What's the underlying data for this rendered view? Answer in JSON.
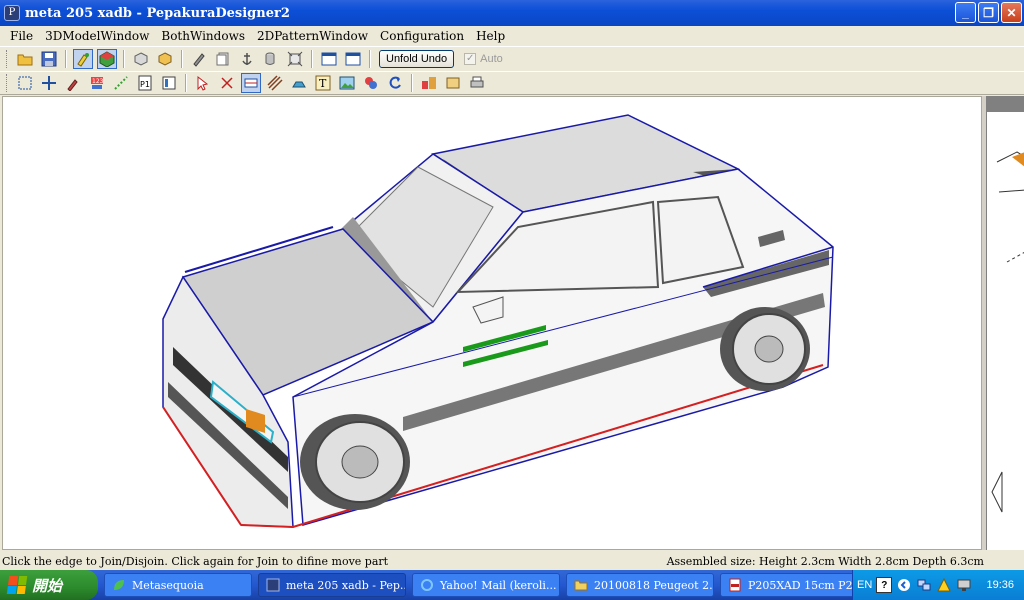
{
  "window": {
    "title": "meta 205 xadb - PepakuraDesigner2",
    "icon": "pepakura-icon",
    "controls": {
      "minimize": "_",
      "restore": "❐",
      "close": "✕"
    }
  },
  "menu": {
    "items": [
      "File",
      "3DModelWindow",
      "BothWindows",
      "2DPatternWindow",
      "Configuration",
      "Help"
    ]
  },
  "toolbar1": {
    "unfold_undo_label": "Unfold Undo",
    "auto_label": "Auto",
    "auto_checked": true,
    "auto_check_glyph": "✓"
  },
  "statusbar": {
    "hint": "Click the edge to Join/Disjoin. Click again for Join to difine move part",
    "assembled_size": "Assembled size: Height 2.3cm Width 2.8cm Depth 6.3cm"
  },
  "taskbar": {
    "start_label": "開始",
    "tasks": [
      {
        "label": "Metasequoia",
        "icon": "leaf-icon",
        "active": false
      },
      {
        "label": "meta 205 xadb - Pep...",
        "icon": "pepakura-icon",
        "active": true
      },
      {
        "label": "Yahoo! Mail (keroli...",
        "icon": "ie-icon",
        "active": false
      },
      {
        "label": "20100818 Peugeot 2...",
        "icon": "folder-icon",
        "active": false
      },
      {
        "label": "P205XAD 15cm P2....",
        "icon": "pdf-icon",
        "active": false
      }
    ],
    "tray": {
      "language": "EN",
      "help": "?",
      "clock": "19:36"
    }
  },
  "colors": {
    "titlebar": "#0c4fd7",
    "edge_blue": "#1a1aa8",
    "edge_red": "#d42020",
    "edge_cyan": "#2ab0c8",
    "stripe_green": "#1a9a1a"
  }
}
